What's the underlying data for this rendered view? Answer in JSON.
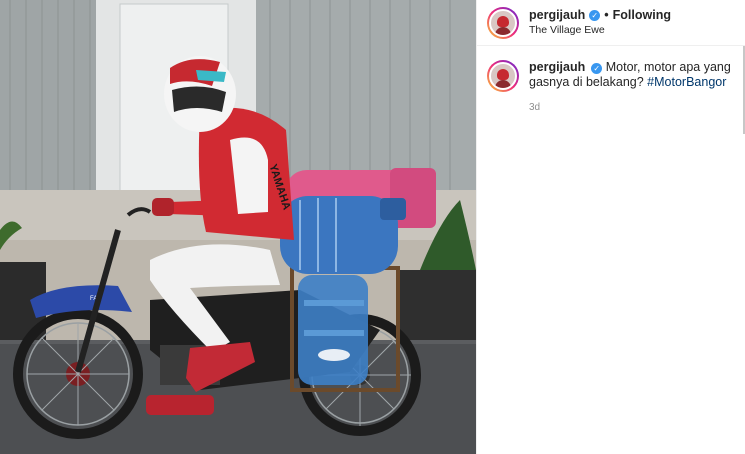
{
  "post": {
    "username": "pergijauh",
    "follow_label": "Following",
    "separator": "•",
    "location": "The Village Ewe",
    "verified_icon": "check-icon",
    "caption": {
      "username": "pergijauh",
      "text": "Motor, motor apa yang gasnya di belakang?",
      "hashtag": "#MotorBangor",
      "time": "3d"
    }
  },
  "photo": {
    "helmet_brand": "",
    "jacket_text": "YAMAHA",
    "bottle_text": "",
    "fender_text": "FAN"
  },
  "colors": {
    "link": "#00376b",
    "verified": "#3897f0",
    "muted": "#8e8e8e"
  }
}
